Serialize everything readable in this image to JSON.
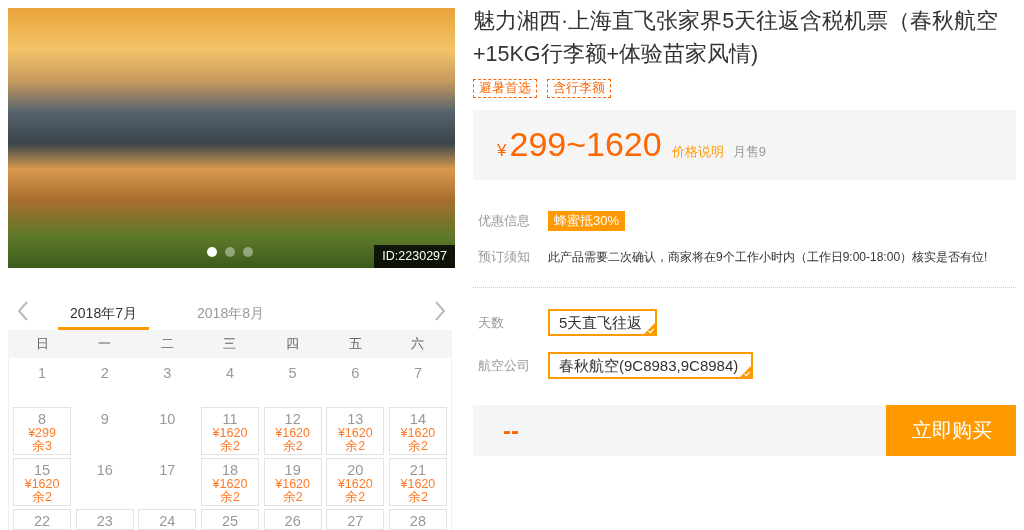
{
  "gallery": {
    "photo_id": "ID:2230297",
    "dots": [
      {
        "selected": true
      },
      {
        "selected": false
      },
      {
        "selected": false
      }
    ]
  },
  "calendar": {
    "months": [
      {
        "label": "2018年7月",
        "selected": true
      },
      {
        "label": "2018年8月",
        "selected": false
      }
    ],
    "weekdays": [
      "日",
      "一",
      "二",
      "三",
      "四",
      "五",
      "六"
    ],
    "weeks": [
      [
        {
          "day": "1",
          "available": false
        },
        {
          "day": "2",
          "available": false
        },
        {
          "day": "3",
          "available": false
        },
        {
          "day": "4",
          "available": false
        },
        {
          "day": "5",
          "available": false
        },
        {
          "day": "6",
          "available": false
        },
        {
          "day": "7",
          "available": false
        }
      ],
      [
        {
          "day": "8",
          "available": true,
          "price": "¥299",
          "remaining": "余3"
        },
        {
          "day": "9",
          "available": false
        },
        {
          "day": "10",
          "available": false
        },
        {
          "day": "11",
          "available": true,
          "price": "¥1620",
          "remaining": "余2"
        },
        {
          "day": "12",
          "available": true,
          "price": "¥1620",
          "remaining": "余2"
        },
        {
          "day": "13",
          "available": true,
          "price": "¥1620",
          "remaining": "余2"
        },
        {
          "day": "14",
          "available": true,
          "price": "¥1620",
          "remaining": "余2"
        }
      ],
      [
        {
          "day": "15",
          "available": true,
          "price": "¥1620",
          "remaining": "余2"
        },
        {
          "day": "16",
          "available": false
        },
        {
          "day": "17",
          "available": false
        },
        {
          "day": "18",
          "available": true,
          "price": "¥1620",
          "remaining": "余2"
        },
        {
          "day": "19",
          "available": true,
          "price": "¥1620",
          "remaining": "余2"
        },
        {
          "day": "20",
          "available": true,
          "price": "¥1620",
          "remaining": "余2"
        },
        {
          "day": "21",
          "available": true,
          "price": "¥1620",
          "remaining": "余2"
        }
      ],
      [
        {
          "day": "22",
          "available": true
        },
        {
          "day": "23",
          "available": true
        },
        {
          "day": "24",
          "available": true
        },
        {
          "day": "25",
          "available": true
        },
        {
          "day": "26",
          "available": true
        },
        {
          "day": "27",
          "available": true
        },
        {
          "day": "28",
          "available": true
        }
      ]
    ]
  },
  "product": {
    "title": "魅力湘西·上海直飞张家界5天往返含税机票（春秋航空+15KG行李额+体验苗家风情)",
    "tags": [
      "避暑首选",
      "含行李额"
    ],
    "price": {
      "currency": "¥",
      "range": "299~1620",
      "note": "价格说明",
      "monthly_sales": "月售9"
    },
    "info": [
      {
        "label": "优惠信息",
        "kind": "badge",
        "value": "蜂蜜抵30%"
      },
      {
        "label": "预订须知",
        "kind": "text",
        "value": "此产品需要二次确认，商家将在9个工作小时内（工作日9:00-18:00）核实是否有位!"
      }
    ],
    "options": [
      {
        "label": "天数",
        "choices": [
          {
            "text": "5天直飞往返",
            "selected": true
          }
        ]
      },
      {
        "label": "航空公司",
        "choices": [
          {
            "text": "春秋航空(9C8983,9C8984)",
            "selected": true
          }
        ]
      }
    ],
    "total": "--",
    "buy_button": "立即购买"
  }
}
